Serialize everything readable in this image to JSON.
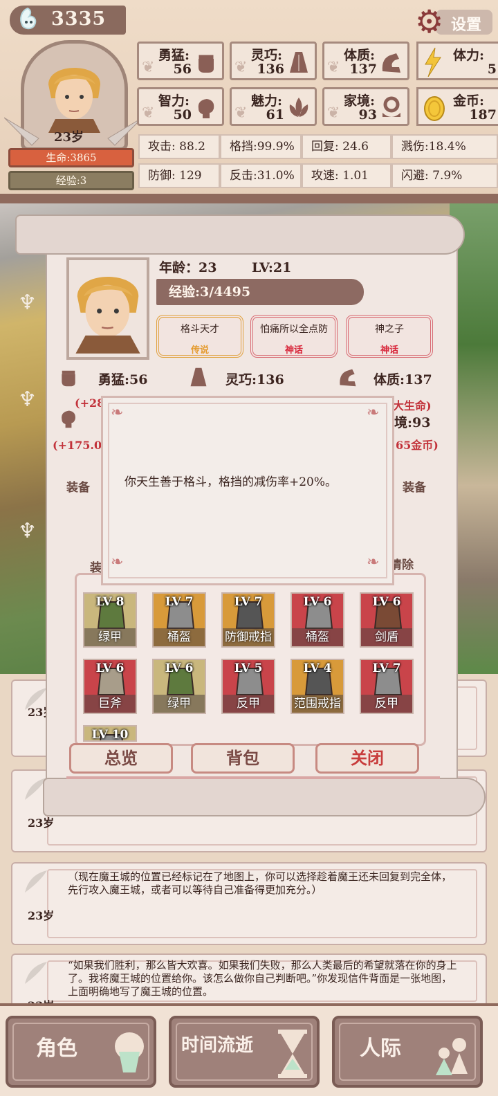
{
  "hud": {
    "soul_count": "3335",
    "settings_label": "设置",
    "age": "23岁",
    "hp": "生命:3865",
    "xp": "经验:3",
    "stats": [
      {
        "label": "勇猛:",
        "value": "56",
        "icon": "fist-icon"
      },
      {
        "label": "灵巧:",
        "value": "136",
        "icon": "cloak-icon"
      },
      {
        "label": "体质:",
        "value": "137",
        "icon": "arm-icon"
      },
      {
        "label": "智力:",
        "value": "50",
        "icon": "brain-icon"
      },
      {
        "label": "魅力:",
        "value": "61",
        "icon": "lotus-icon"
      },
      {
        "label": "家境:",
        "value": "93",
        "icon": "home-icon"
      }
    ],
    "stamina": {
      "label": "体力:",
      "value": "5",
      "icon": "lightning-icon"
    },
    "gold": {
      "label": "金币:",
      "value": "187",
      "icon": "coin-icon"
    },
    "attributes_row1": [
      {
        "label": "攻击:",
        "value": "88.2"
      },
      {
        "label": "格挡:",
        "value": "99.9%"
      },
      {
        "label": "回复:",
        "value": "24.6"
      },
      {
        "label": "溅伤:",
        "value": "18.4%"
      }
    ],
    "attributes_row2": [
      {
        "label": "防御:",
        "value": "129"
      },
      {
        "label": "反击:",
        "value": "31.0%"
      },
      {
        "label": "攻速:",
        "value": "1.01"
      },
      {
        "label": "闪避:",
        "value": "7.9%"
      }
    ]
  },
  "character": {
    "age_label": "年龄：",
    "age_value": "23",
    "level": "LV:21",
    "exp": "经验:3/4495",
    "talents": [
      {
        "name": "格斗天才",
        "rarity": "传说"
      },
      {
        "name": "怕痛所以全点防",
        "rarity": "神话"
      },
      {
        "name": "神之子",
        "rarity": "神话"
      }
    ],
    "stat_bravery": "勇猛:56",
    "stat_agility": "灵巧:136",
    "stat_constitution": "体质:137",
    "bonus_left1": "(+28",
    "bonus_right1": "大生命)",
    "bonus_left2": "(+175.0",
    "stat_family": "境:93",
    "bonus_right2": "65金币)",
    "equip_left": "装备",
    "equip_right": "装备",
    "tab_partial": "装",
    "clear_label": "清除"
  },
  "equipment": [
    {
      "lv": "LV 8",
      "name": "绿甲",
      "color": "#5e7a3e",
      "bg": "#c9b77d"
    },
    {
      "lv": "LV 7",
      "name": "桶盔",
      "color": "#8d8d8d",
      "bg": "#d89a3a"
    },
    {
      "lv": "LV 7",
      "name": "防御戒指",
      "color": "#555555",
      "bg": "#d89a3a"
    },
    {
      "lv": "LV 6",
      "name": "桶盔",
      "color": "#8d8d8d",
      "bg": "#c9444a"
    },
    {
      "lv": "LV 6",
      "name": "剑盾",
      "color": "#7a4a35",
      "bg": "#c9444a"
    },
    {
      "lv": "LV 6",
      "name": "巨斧",
      "color": "#a89d8a",
      "bg": "#c9444a"
    },
    {
      "lv": "LV 6",
      "name": "绿甲",
      "color": "#5e7a3e",
      "bg": "#c9b77d"
    },
    {
      "lv": "LV 5",
      "name": "反甲",
      "color": "#8d8d8d",
      "bg": "#c9444a"
    },
    {
      "lv": "LV 4",
      "name": "范围戒指",
      "color": "#555555",
      "bg": "#d89a3a"
    },
    {
      "lv": "LV 7",
      "name": "反甲",
      "color": "#8d8d8d",
      "bg": "#c9444a"
    },
    {
      "lv": "LV 10",
      "name": "",
      "color": "#8d8d8d",
      "bg": "#c9b77d"
    }
  ],
  "buttons": {
    "overview": "总览",
    "backpack": "背包",
    "close": "关闭"
  },
  "popup": {
    "text": "你天生善于格斗，格挡的减伤率+20%。"
  },
  "log": [
    {
      "age": "23岁",
      "text": ""
    },
    {
      "age": "23岁",
      "text": ""
    },
    {
      "age": "23岁",
      "text": "（现在魔王城的位置已经标记在了地图上，你可以选择趁着魔王还未回复到完全体，先行攻入魔王城，或者可以等待自己准备得更加充分。）"
    },
    {
      "age": "23岁",
      "text": "“如果我们胜利，那么皆大欢喜。如果我们失败，那么人类最后的希望就落在你的身上了。我将魔王城的位置给你。该怎么做你自己判断吧。”你发现信件背面是一张地图，上面明确地写了魔王城的位置。"
    }
  ],
  "nav": {
    "character": "角色",
    "time": "时间流逝",
    "social": "人际"
  }
}
